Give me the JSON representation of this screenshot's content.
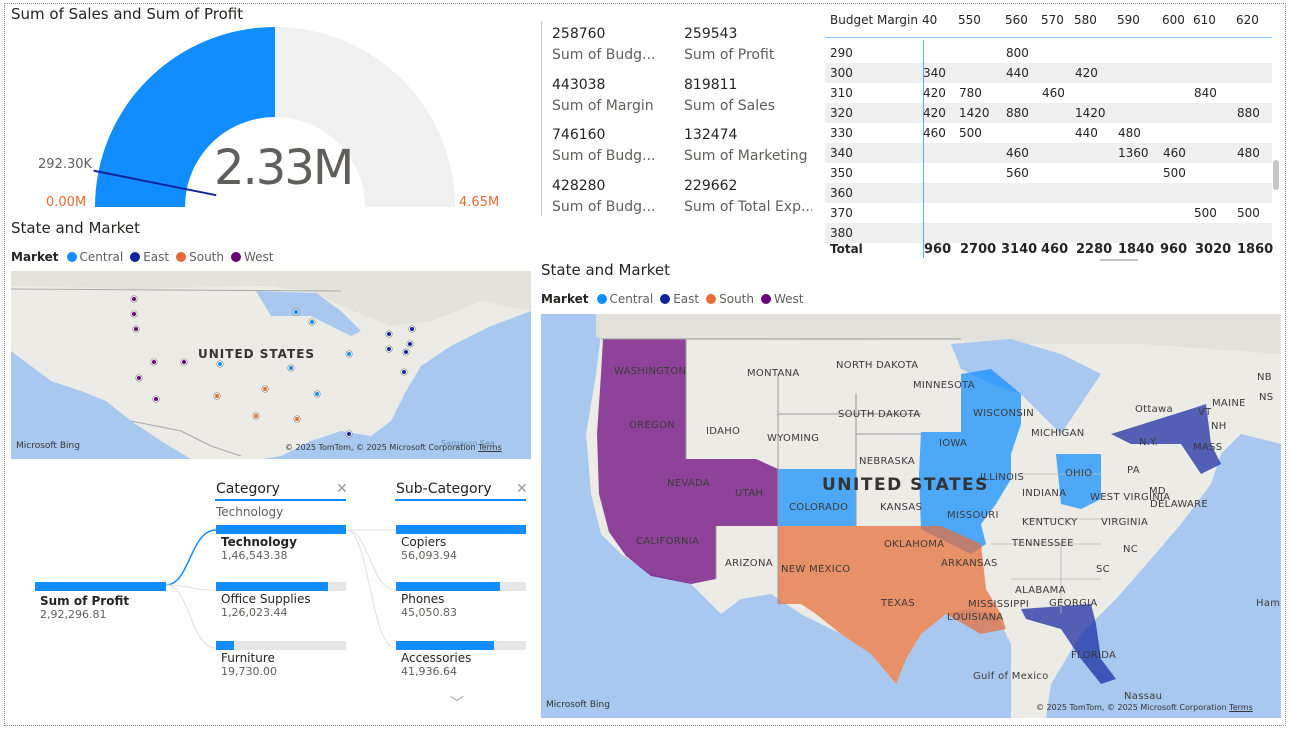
{
  "gauge": {
    "title": "Sum of Sales and Sum of Profit",
    "value": "2.33M",
    "target_label": "292.30K",
    "min_label": "0.00M",
    "max_label": "4.65M",
    "value_fraction": 0.5,
    "target_fraction": 0.0629,
    "fill_color": "#118dff",
    "track_color": "#f0f0f0",
    "target_color": "#12239e",
    "minmax_color": "#e66c37"
  },
  "map_small": {
    "title": "State and Market",
    "legend_title": "Market",
    "legend": [
      {
        "label": "Central",
        "color": "#118dff"
      },
      {
        "label": "East",
        "color": "#12239e"
      },
      {
        "label": "South",
        "color": "#e66c37"
      },
      {
        "label": "West",
        "color": "#6b007b"
      }
    ],
    "country_label": "UNITED STATES",
    "sea_label": "Sargasso Sea",
    "bing_label": "Microsoft Bing",
    "credit": "© 2025 TomTom, © 2025 Microsoft Corporation",
    "terms": "Terms"
  },
  "cards": [
    {
      "value": "258760",
      "label": "Sum of Budg..."
    },
    {
      "value": "259543",
      "label": "Sum of Profit"
    },
    {
      "value": "443038",
      "label": "Sum of Margin"
    },
    {
      "value": "819811",
      "label": "Sum of Sales"
    },
    {
      "value": "746160",
      "label": "Sum of Budg..."
    },
    {
      "value": "132474",
      "label": "Sum of Marketing"
    },
    {
      "value": "428280",
      "label": "Sum of Budg..."
    },
    {
      "value": "229662",
      "label": "Sum of Total Exp..."
    }
  ],
  "matrix": {
    "corner_label": "Budget Margin",
    "columns": [
      "40",
      "550",
      "560",
      "570",
      "580",
      "590",
      "600",
      "610",
      "620"
    ],
    "rows": [
      {
        "label": "290",
        "cells": [
          "",
          "",
          "800",
          "",
          "",
          "",
          "",
          "",
          ""
        ]
      },
      {
        "label": "300",
        "cells": [
          "340",
          "",
          "440",
          "",
          "420",
          "",
          "",
          "",
          ""
        ]
      },
      {
        "label": "310",
        "cells": [
          "420",
          "780",
          "",
          "460",
          "",
          "",
          "",
          "840",
          ""
        ]
      },
      {
        "label": "320",
        "cells": [
          "420",
          "1420",
          "880",
          "",
          "1420",
          "",
          "",
          "",
          "880"
        ]
      },
      {
        "label": "330",
        "cells": [
          "460",
          "500",
          "",
          "",
          "440",
          "480",
          "",
          "",
          ""
        ]
      },
      {
        "label": "340",
        "cells": [
          "",
          "",
          "460",
          "",
          "",
          "1360",
          "460",
          "",
          "480"
        ]
      },
      {
        "label": "350",
        "cells": [
          "",
          "",
          "560",
          "",
          "",
          "",
          "500",
          "",
          ""
        ]
      },
      {
        "label": "360",
        "cells": [
          "",
          "",
          "",
          "",
          "",
          "",
          "",
          "",
          ""
        ]
      },
      {
        "label": "370",
        "cells": [
          "",
          "",
          "",
          "",
          "",
          "",
          "",
          "500",
          "500"
        ]
      },
      {
        "label": "380",
        "cells": [
          "",
          "",
          "",
          "",
          "",
          "",
          "",
          "",
          ""
        ]
      }
    ],
    "total_label": "Total",
    "totals": [
      "960",
      "2700",
      "3140",
      "460",
      "2280",
      "1840",
      "960",
      "3020",
      "1860"
    ]
  },
  "map_large": {
    "title": "State and Market",
    "legend_title": "Market",
    "country_label": "UNITED STATES",
    "states": {
      "washington": "WASHINGTON",
      "oregon": "OREGON",
      "idaho": "IDAHO",
      "montana": "MONTANA",
      "wyoming": "WYOMING",
      "nevada": "NEVADA",
      "utah": "UTAH",
      "california": "CALIFORNIA",
      "arizona": "ARIZONA",
      "colorado": "COLORADO",
      "new_mexico": "NEW MEXICO",
      "north_dakota": "NORTH DAKOTA",
      "south_dakota": "SOUTH DAKOTA",
      "nebraska": "NEBRASKA",
      "kansas": "KANSAS",
      "oklahoma": "OKLAHOMA",
      "texas": "TEXAS",
      "minnesota": "MINNESOTA",
      "iowa": "IOWA",
      "missouri": "MISSOURI",
      "arkansas": "ARKANSAS",
      "louisiana": "LOUISIANA",
      "wisconsin": "WISCONSIN",
      "illinois": "ILLINOIS",
      "michigan": "MICHIGAN",
      "indiana": "INDIANA",
      "ohio": "OHIO",
      "kentucky": "KENTUCKY",
      "tennessee": "TENNESSEE",
      "mississippi": "MISSISSIPPI",
      "alabama": "ALABAMA",
      "georgia": "GEORGIA",
      "florida": "FLORIDA",
      "pa": "PA",
      "west_virginia": "WEST VIRGINIA",
      "virginia": "VIRGINIA",
      "nc": "NC",
      "sc": "SC",
      "md": "MD",
      "delaware": "DELAWARE",
      "ny": "N.Y.",
      "mass": "MASS",
      "vt": "VT",
      "nh": "NH",
      "maine": "MAINE",
      "nb": "NB",
      "ns": "NS",
      "ottawa": "Ottawa",
      "gulf": "Gulf of Mexico",
      "nassau": "Nassau",
      "ham": "Ham"
    },
    "bing_label": "Microsoft Bing",
    "credit": "© 2025 TomTom, © 2025 Microsoft Corporation",
    "terms": "Terms"
  },
  "decomp": {
    "root_label": "Sum of Profit",
    "root_value": "2,92,296.81",
    "level1_header": "Category",
    "level1_filter": "Technology",
    "level1": [
      {
        "name": "Technology",
        "value": "1,46,543.38",
        "fraction": 1.0
      },
      {
        "name": "Office Supplies",
        "value": "1,26,023.44",
        "fraction": 0.86
      },
      {
        "name": "Furniture",
        "value": "19,730.00",
        "fraction": 0.135
      }
    ],
    "level2_header": "Sub-Category",
    "level2": [
      {
        "name": "Copiers",
        "value": "56,093.94",
        "fraction": 1.0
      },
      {
        "name": "Phones",
        "value": "45,050.83",
        "fraction": 0.8
      },
      {
        "name": "Accessories",
        "value": "41,936.64",
        "fraction": 0.75
      }
    ]
  }
}
